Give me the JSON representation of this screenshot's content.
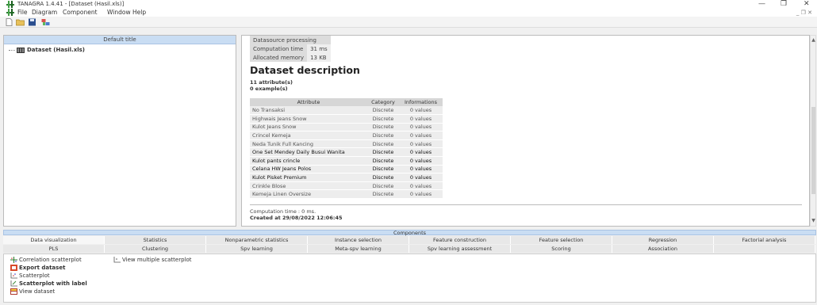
{
  "window": {
    "title": "TANAGRA 1.4.41 - [Dataset (Hasil.xls)]",
    "minimize": "—",
    "maximize": "❐",
    "close": "✕"
  },
  "menu": {
    "items": [
      "File",
      "Diagram",
      "Component",
      "Window",
      "Help"
    ],
    "mdi_buttons": "_ ❐ ✕"
  },
  "tree": {
    "header": "Default title",
    "node": "Dataset (Hasil.xls)"
  },
  "result": {
    "info_rows": [
      {
        "key": "Datasource processing",
        "value": ""
      },
      {
        "key": "Computation time",
        "value": "31 ms"
      },
      {
        "key": "Allocated memory",
        "value": "13 KB"
      }
    ],
    "title": "Dataset description",
    "attributes_count": "11 attribute(s)",
    "examples_count": "0 example(s)",
    "table_headers": [
      "Attribute",
      "Category",
      "Informations"
    ],
    "rows": [
      {
        "attribute": "No Transaksi",
        "category": "Discrete",
        "info": "0 values"
      },
      {
        "attribute": "Highwais Jeans Snow",
        "category": "Discrete",
        "info": "0 values"
      },
      {
        "attribute": "Kulot Jeans Snow",
        "category": "Discrete",
        "info": "0 values"
      },
      {
        "attribute": "Crincel Kemeja",
        "category": "Discrete",
        "info": "0 values"
      },
      {
        "attribute": "Neda Tunik Full Kancing",
        "category": "Discrete",
        "info": "0 values"
      },
      {
        "attribute": "One Set Mendey Daily Busui Wanita",
        "category": "Discrete",
        "info": "0 values"
      },
      {
        "attribute": "Kulot pants crincle",
        "category": "Discrete",
        "info": "0 values"
      },
      {
        "attribute": "Celana HW Jeans Polos",
        "category": "Discrete",
        "info": "0 values"
      },
      {
        "attribute": "Kulot Pisket Premium",
        "category": "Discrete",
        "info": "0 values"
      },
      {
        "attribute": "Crinkle Blose",
        "category": "Discrete",
        "info": "0 values"
      },
      {
        "attribute": "Kemeja Linen Oversize",
        "category": "Discrete",
        "info": "0 values"
      }
    ],
    "computation_time": "Computation time : 0 ms.",
    "created_at": "Created at 29/08/2022 12:06:45"
  },
  "components": {
    "header": "Components",
    "tabs_row1": [
      "Data visualization",
      "Statistics",
      "Nonparametric statistics",
      "Instance selection",
      "Feature construction",
      "Feature selection",
      "Regression",
      "Factorial analysis"
    ],
    "tabs_row2": [
      "PLS",
      "Clustering",
      "Spv learning",
      "Meta-spv learning",
      "Spv learning assessment",
      "Scoring",
      "Association",
      ""
    ],
    "items": [
      "Correlation scatterplot",
      "View multiple scatterplot",
      "Export dataset",
      "Scatterplot",
      "Scatterplot with label",
      "View dataset"
    ]
  }
}
